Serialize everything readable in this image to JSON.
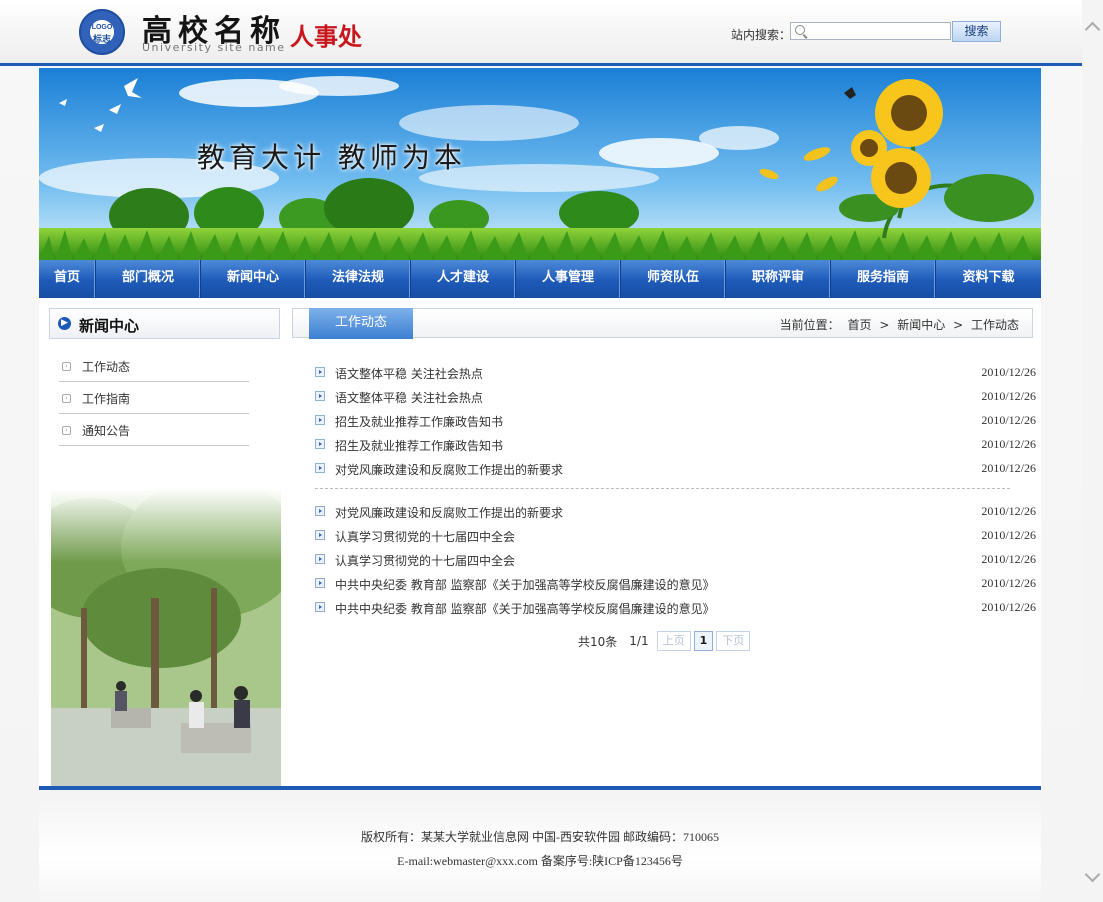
{
  "header": {
    "logo_text_small": "LOGO",
    "logo_text_seal": "标志",
    "site_name": "高校名称",
    "site_name_en": "University site name",
    "department": "人事处",
    "search_label": "站内搜索：",
    "search_value": "",
    "search_button": "搜索"
  },
  "banner": {
    "slogan": "教育大计 教师为本"
  },
  "nav": [
    "首页",
    "部门概况",
    "新闻中心",
    "法律法规",
    "人才建设",
    "人事管理",
    "师资队伍",
    "职称评审",
    "服务指南",
    "资料下载"
  ],
  "sidebar": {
    "title": "新闻中心",
    "items": [
      "工作动态",
      "工作指南",
      "通知公告"
    ]
  },
  "content": {
    "active_tab": "工作动态",
    "breadcrumb_label": "当前位置：",
    "breadcrumb": [
      "首页",
      "新闻中心",
      "工作动态"
    ],
    "breadcrumb_sep": ">",
    "news_group1": [
      {
        "title": "语文整体平稳 关注社会热点",
        "date": "2010/12/26"
      },
      {
        "title": "语文整体平稳 关注社会热点",
        "date": "2010/12/26"
      },
      {
        "title": "招生及就业推荐工作廉政告知书",
        "date": "2010/12/26"
      },
      {
        "title": "招生及就业推荐工作廉政告知书",
        "date": "2010/12/26"
      },
      {
        "title": "对党风廉政建设和反腐败工作提出的新要求",
        "date": "2010/12/26"
      }
    ],
    "news_group2": [
      {
        "title": "对党风廉政建设和反腐败工作提出的新要求",
        "date": "2010/12/26"
      },
      {
        "title": "认真学习贯彻党的十七届四中全会",
        "date": "2010/12/26"
      },
      {
        "title": "认真学习贯彻党的十七届四中全会",
        "date": "2010/12/26"
      },
      {
        "title": "中共中央纪委 教育部 监察部《关于加强高等学校反腐倡廉建设的意见》",
        "date": "2010/12/26"
      },
      {
        "title": "中共中央纪委 教育部 监察部《关于加强高等学校反腐倡廉建设的意见》",
        "date": "2010/12/26"
      }
    ],
    "pager": {
      "total": "共10条",
      "page": "1/1",
      "prev": "上页",
      "current": "1",
      "next": "下页"
    }
  },
  "footer": {
    "line1": "版权所有：某某大学就业信息网 中国-西安软件园  邮政编码：710065",
    "line2": "E-mail:webmaster@xxx.com 备案序号:陕ICP备123456号"
  },
  "colors": {
    "brand_blue": "#1e5bb4",
    "dept_red": "#c8161d",
    "nav_blue": "#1d5ab8"
  }
}
